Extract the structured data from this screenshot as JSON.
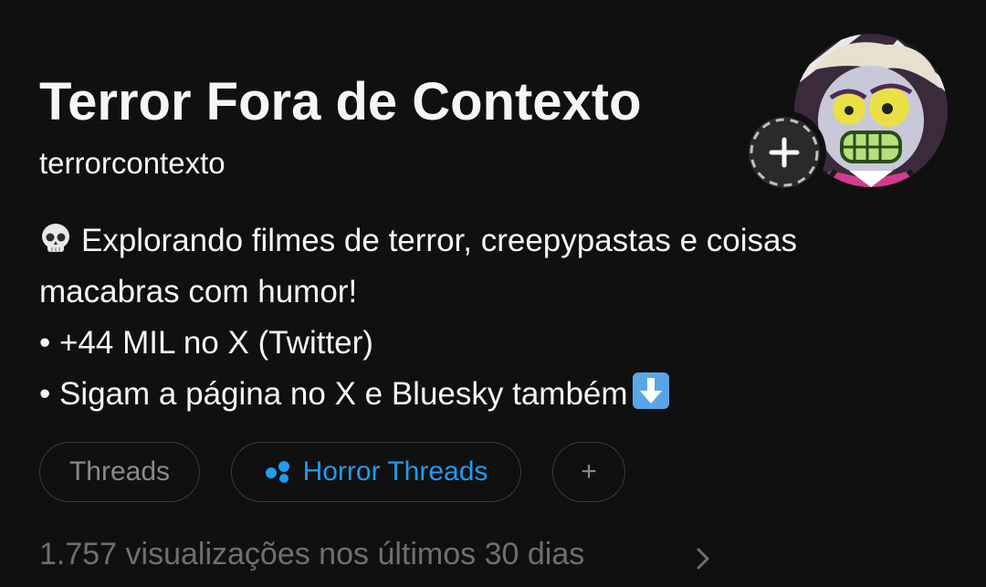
{
  "profile": {
    "display_name": "Terror Fora de Contexto",
    "username": "terrorcontexto",
    "avatar_icon": "cartoon-character-avatar",
    "add_icon": "plus-icon"
  },
  "bio": {
    "line1_emoji": "skull-emoji",
    "line1": "Explorando filmes de terror, creepypastas e coisas",
    "line2": "macabras com humor!",
    "line3": "• +44 MIL no X (Twitter)",
    "line4": "• Sigam a página no X e Bluesky também",
    "line4_emoji": "down-arrow-emoji"
  },
  "chips": {
    "threads_label": "Threads",
    "horror_label": "Horror Threads",
    "add_label": "+"
  },
  "insights": {
    "views_text": "1.757 visualizações nos últimos 30 dias"
  },
  "colors": {
    "background": "#101010",
    "text_primary": "#f3f5f7",
    "text_muted": "#6f6f6f",
    "accent_blue": "#1f9cf0"
  }
}
